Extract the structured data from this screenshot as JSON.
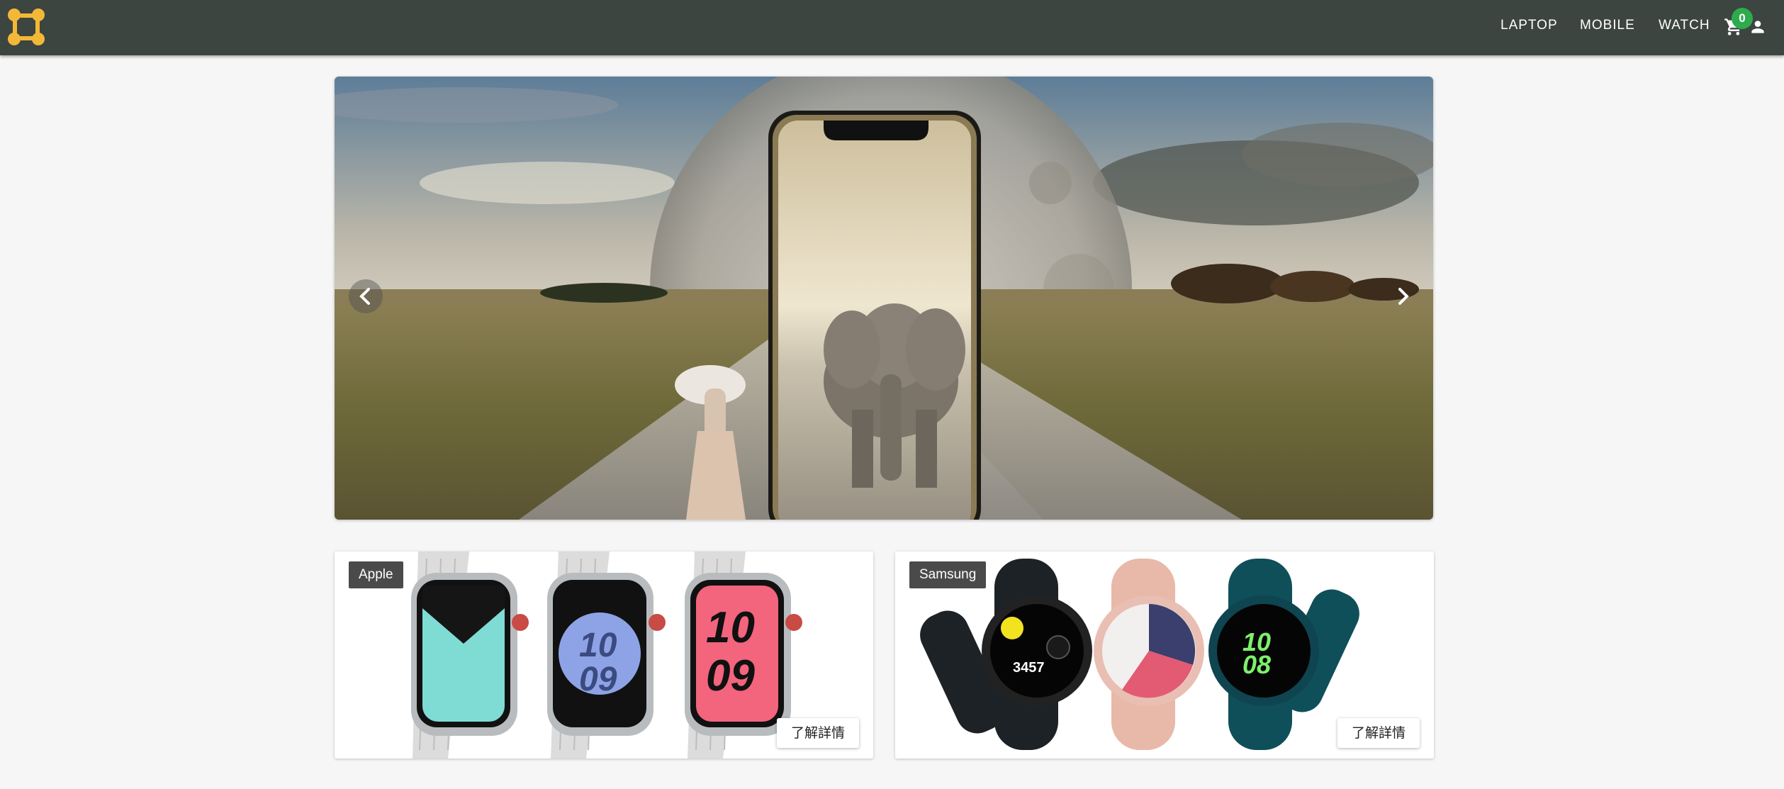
{
  "header": {
    "logo_icon": "logo-icon",
    "nav": [
      {
        "label": "LAPTOP"
      },
      {
        "label": "MOBILE"
      },
      {
        "label": "WATCH"
      }
    ],
    "cart_count": "0",
    "cart_icon": "shopping-cart-icon",
    "user_icon": "user-icon",
    "colors": {
      "bar": "#3d4540",
      "badge": "#2eab4d",
      "logo": "#f3b837"
    }
  },
  "carousel": {
    "prev_icon": "chevron-left-icon",
    "next_icon": "chevron-right-icon"
  },
  "cards": [
    {
      "brand": "Apple",
      "button_label": "了解詳情",
      "watch_faces": [
        {
          "line1": ""
        },
        {
          "line1": "10",
          "line2": "09"
        },
        {
          "line1": "10",
          "line2": "09"
        }
      ]
    },
    {
      "brand": "Samsung",
      "button_label": "了解詳情",
      "watch_faces": [
        {
          "line1": "3457"
        },
        {
          "line1": ""
        },
        {
          "line1": "10",
          "line2": "08"
        }
      ]
    }
  ]
}
